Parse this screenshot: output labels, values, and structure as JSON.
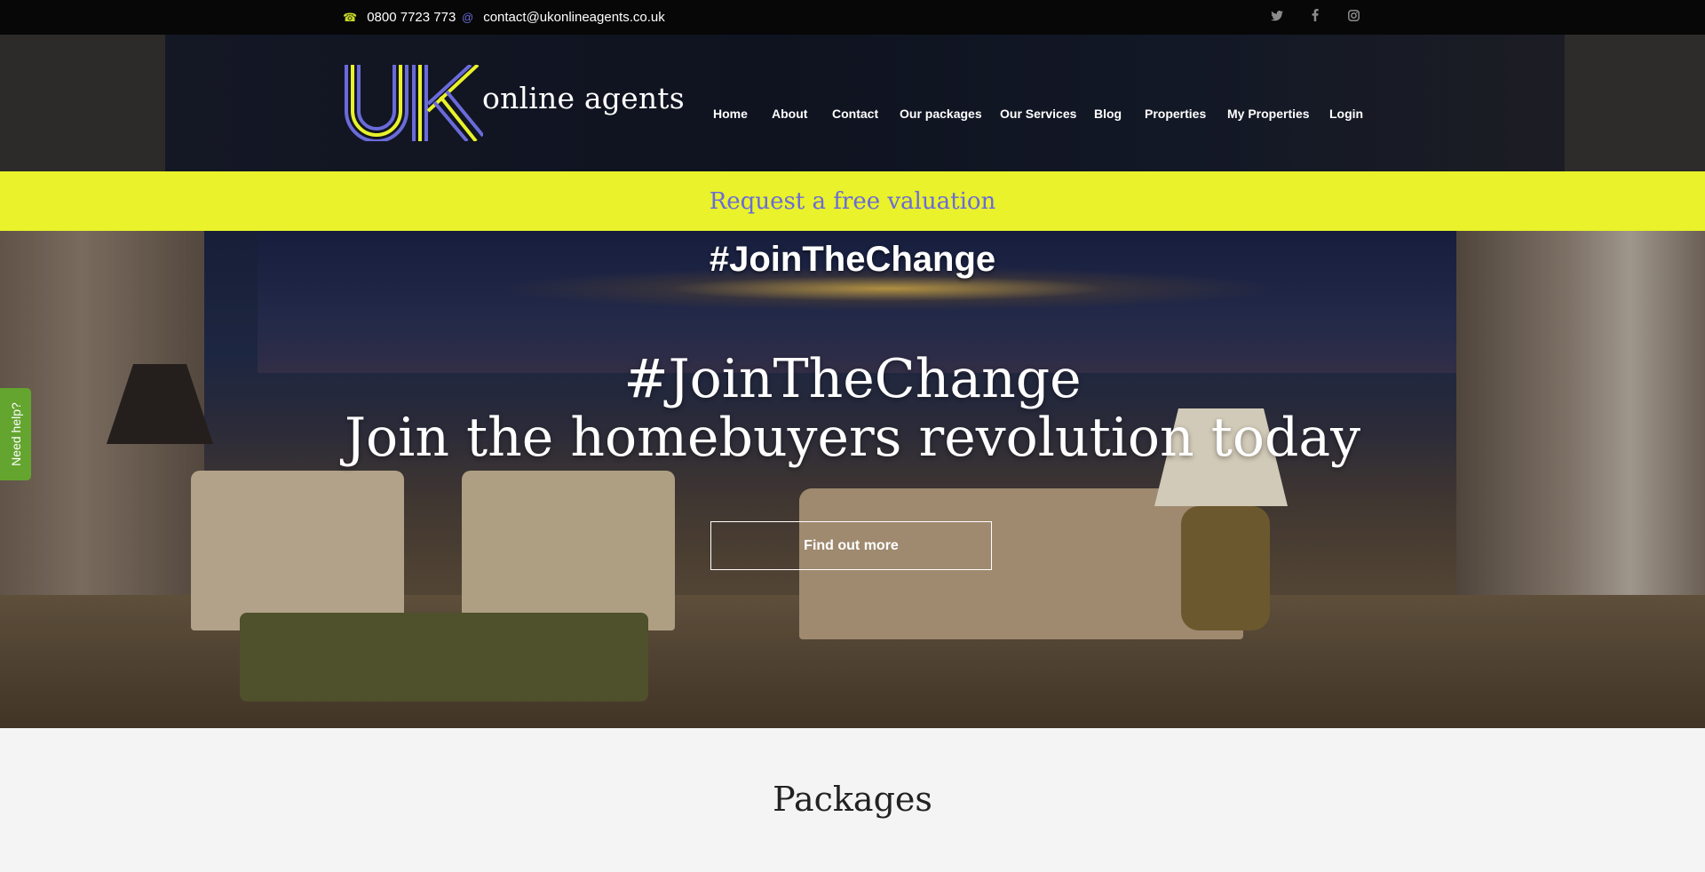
{
  "topbar": {
    "phone": "0800 7723 773",
    "email": "contact@ukonlineagents.co.uk",
    "social": [
      "twitter-icon",
      "facebook-icon",
      "instagram-icon"
    ]
  },
  "header": {
    "logo_mark": "UK",
    "logo_text": "online agents",
    "nav": [
      "Home",
      "About",
      "Contact",
      "Our packages",
      "Our Services",
      "Blog",
      "Properties",
      "My Properties",
      "Login"
    ]
  },
  "valuation": {
    "label": "Request a free valuation"
  },
  "hero": {
    "tag": "#JoinTheChange",
    "tag_large": "#JoinTheChange",
    "title": "Join the homebuyers revolution today",
    "cta": "Find out more"
  },
  "help_tab": {
    "label": "Need help?"
  },
  "packages": {
    "title": "Packages"
  },
  "colors": {
    "accent_yellow": "#e9f22a",
    "accent_blue": "#6a6bd9",
    "help_green": "#64a52f",
    "topbar_bg": "#070707"
  }
}
